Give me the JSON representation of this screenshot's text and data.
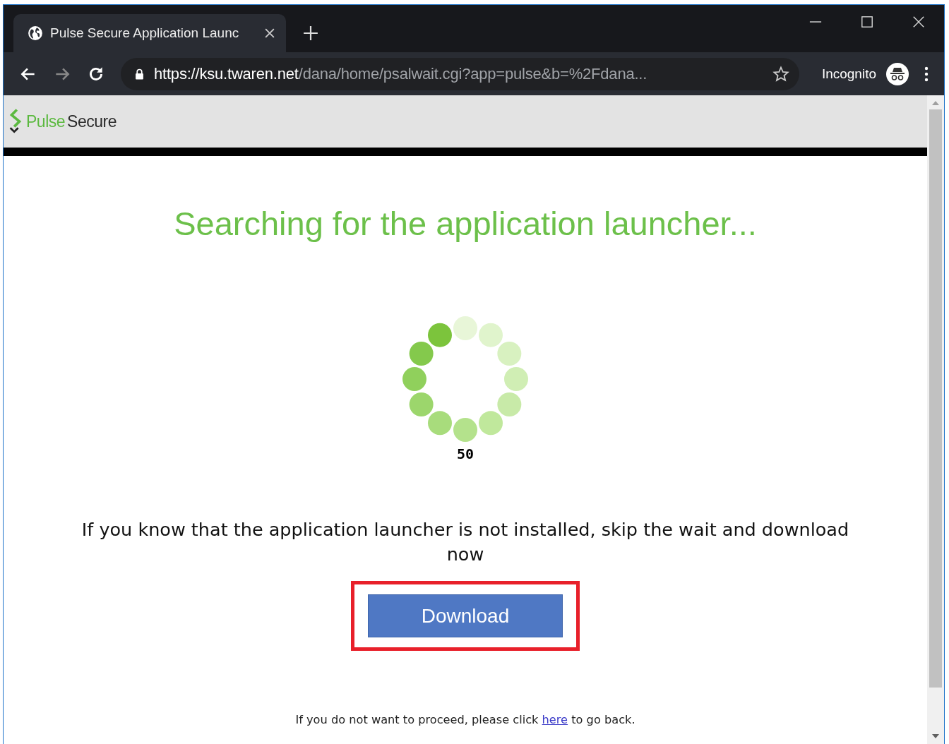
{
  "tab": {
    "title": "Pulse Secure Application Launc",
    "selected": true
  },
  "address": {
    "host": "https://ksu.twaren.net",
    "path": "/dana/home/psalwait.cgi?app=pulse&b=%2Fdana..."
  },
  "profile": {
    "label": "Incognito"
  },
  "logo": {
    "first": "Pulse",
    "second": "Secure"
  },
  "page": {
    "heading": "Searching for the application launcher...",
    "counter": "50",
    "message": "If you know that the application launcher is not installed, skip the wait and download now",
    "button": "Download",
    "highlighted": true,
    "footer": {
      "before": "If you do not want to proceed, please click ",
      "link": "here",
      "after": " to go back."
    }
  }
}
